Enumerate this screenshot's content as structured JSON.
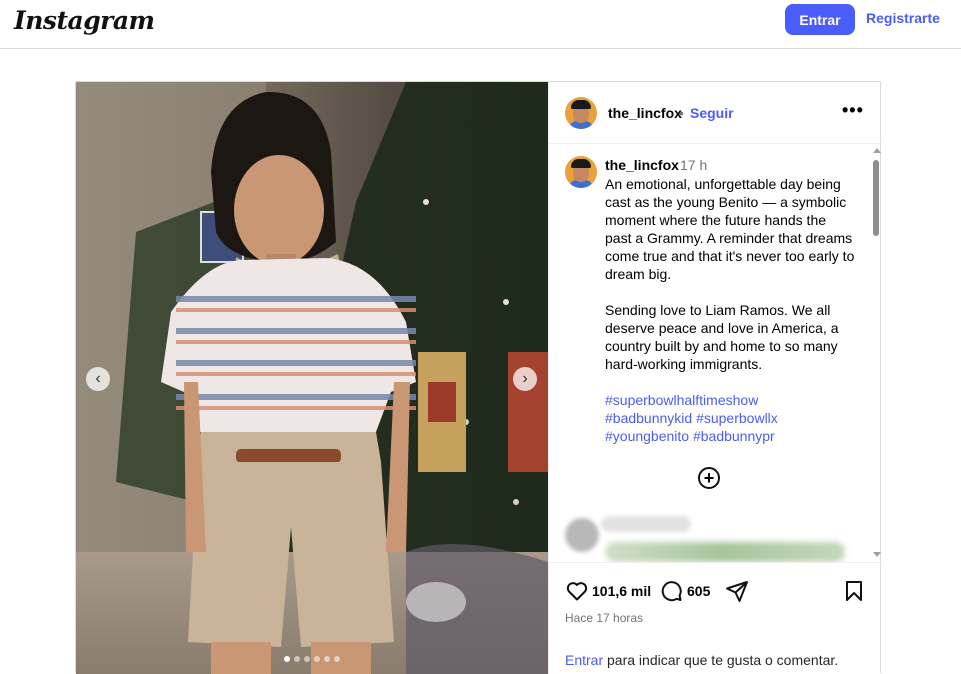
{
  "header": {
    "logo": "Instagram",
    "login_label": "Entrar",
    "signup_label": "Registrarte"
  },
  "post": {
    "username": "the_lincfox",
    "separator": "•",
    "follow_label": "Seguir",
    "more_label": "•••",
    "caption": {
      "username": "the_lincfox",
      "time": "17 h",
      "paragraph1": "An emotional, unforgettable day being cast as the young Benito — a symbolic moment where the future hands the past a Grammy. A reminder that dreams come true and that it's never too early to dream big.",
      "paragraph2": "Sending love to Liam Ramos. We all deserve peace and love in America, a country built by and home to so many hard-working immigrants.",
      "hashtags": [
        "#superbowlhalftimeshow",
        "#badbunnykid #superbowllx",
        "#youngbenito #badbunnypr"
      ]
    },
    "load_more_icon": "plus-circle-icon",
    "likes": "101,6 mil",
    "comments_count": "605",
    "time_ago": "Hace 17 horas",
    "login_link": "Entrar",
    "login_prompt": " para indicar que te gusta o comentar.",
    "carousel": {
      "total": 6,
      "active_index": 1
    }
  },
  "icons": {
    "like": "heart-icon",
    "comment": "comment-icon",
    "share": "share-icon",
    "save": "bookmark-icon",
    "prev": "chevron-left-icon",
    "next": "chevron-right-icon"
  },
  "colors": {
    "accent": "#4a5df9",
    "muted": "#737373",
    "border": "#dbdbdb"
  }
}
